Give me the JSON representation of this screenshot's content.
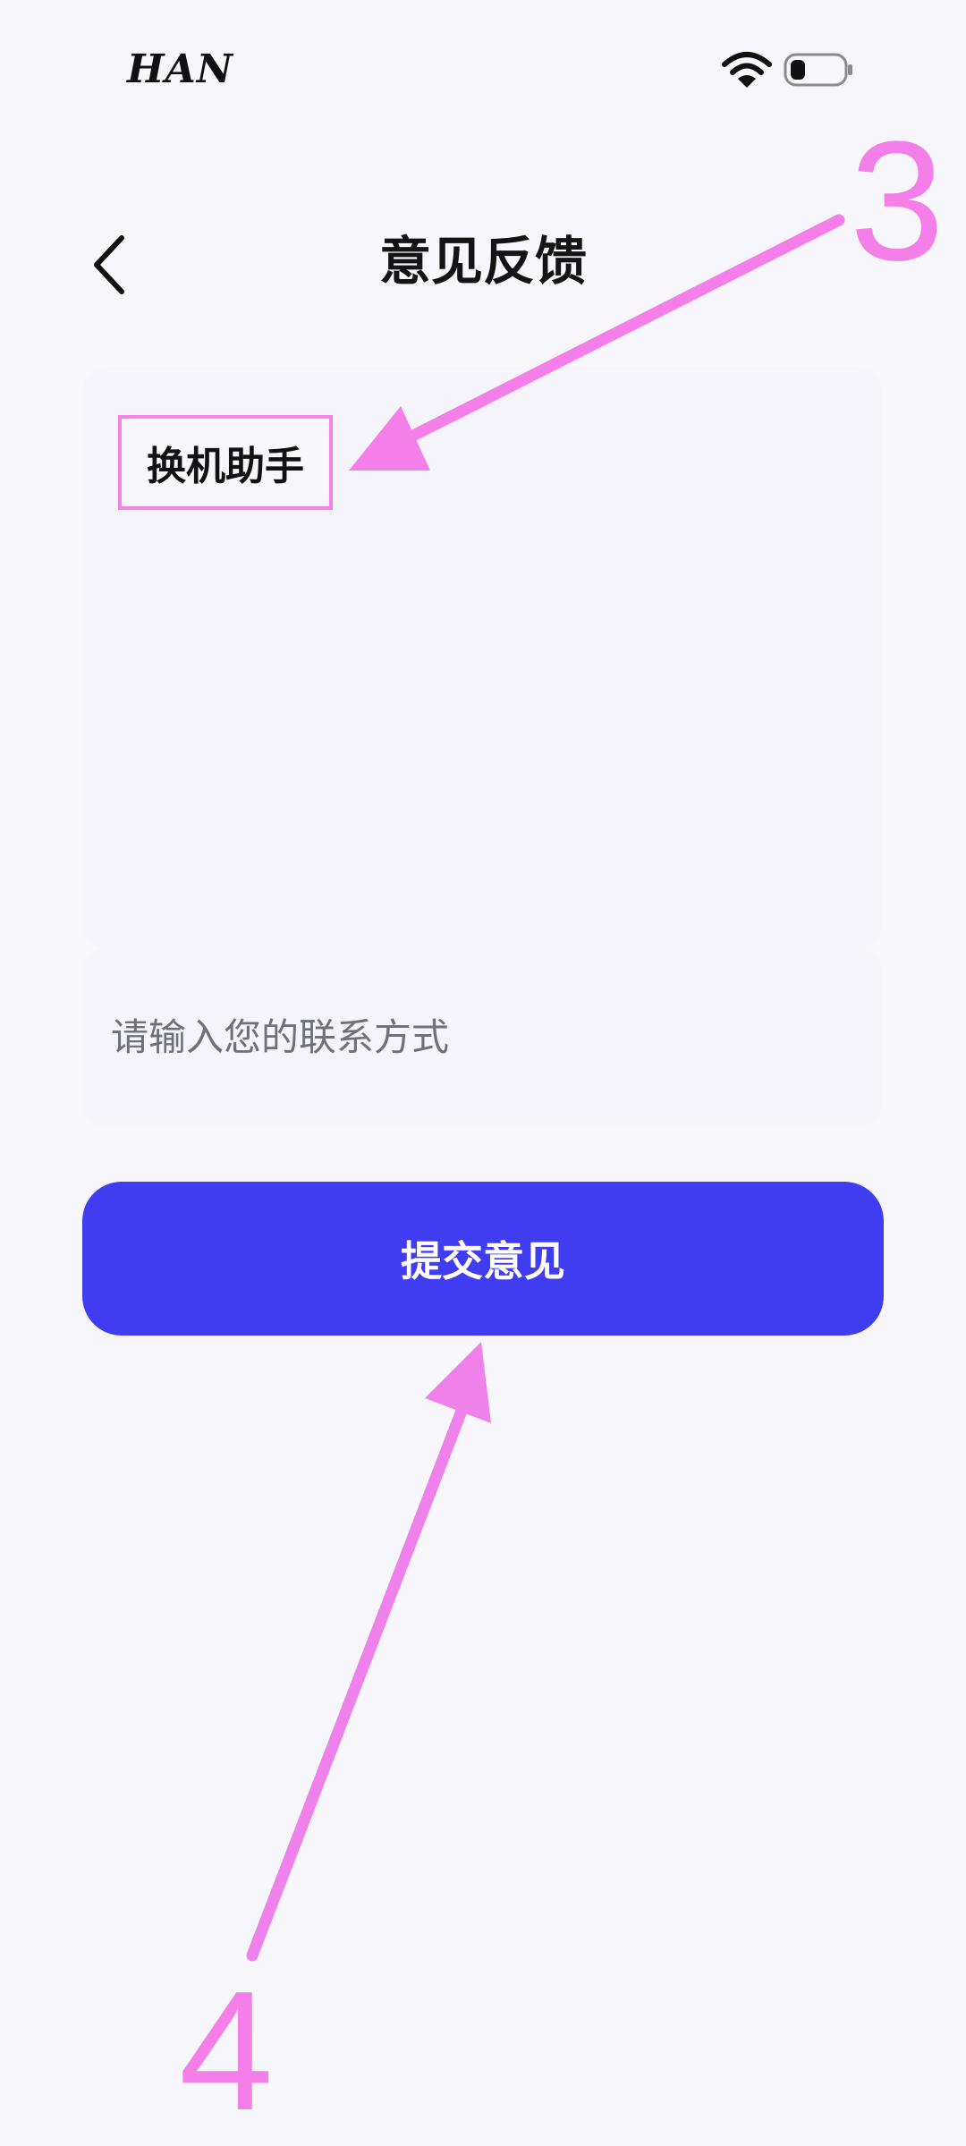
{
  "status_bar": {
    "carrier": "HAN",
    "icons": [
      "wifi-icon",
      "battery-icon"
    ]
  },
  "header": {
    "back_icon": "chevron-left-icon",
    "title": "意见反馈"
  },
  "feedback": {
    "selected_app": "换机助手"
  },
  "contact": {
    "placeholder": "请输入您的联系方式",
    "value": ""
  },
  "submit": {
    "label": "提交意见"
  },
  "annotations": {
    "step_3": "3",
    "step_4": "4",
    "color": "#f47fe8"
  },
  "colors": {
    "background": "#f6f6fb",
    "accent": "#3f3cf2",
    "annotation": "#f47fe8"
  }
}
